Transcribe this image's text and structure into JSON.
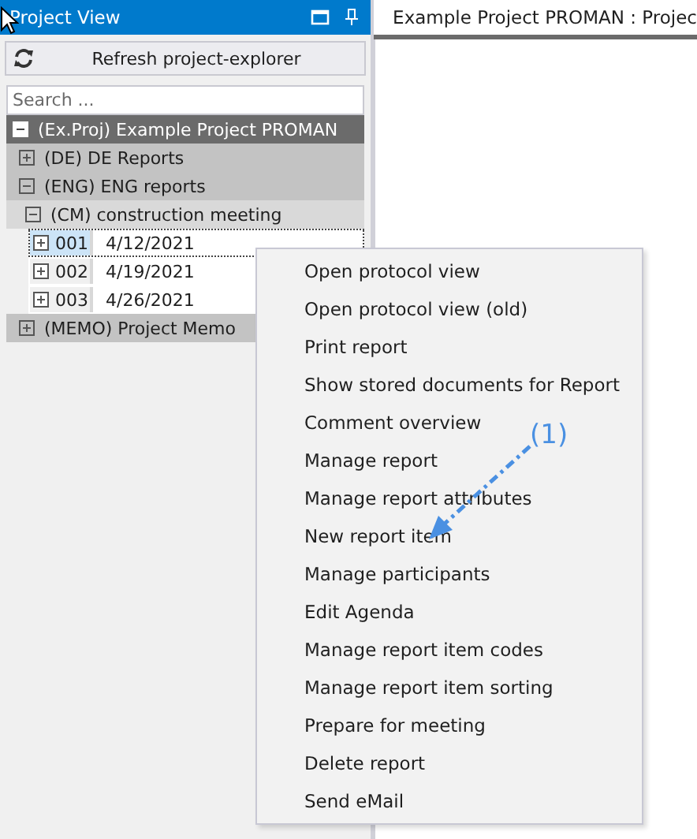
{
  "panel": {
    "title": "Project View",
    "refresh_button": "Refresh project-explorer",
    "search": {
      "placeholder": "Search ..."
    }
  },
  "tree": [
    {
      "label": "(Ex.Proj) Example Project PROMAN",
      "expanded": true,
      "children": [
        {
          "label": "(DE) DE Reports",
          "expanded": false
        },
        {
          "label": "(ENG) ENG reports",
          "expanded": true,
          "children": [
            {
              "label": "(CM) construction meeting",
              "expanded": true,
              "children": [
                {
                  "kind": "report",
                  "number": "001",
                  "date": "4/12/2021",
                  "expanded": false,
                  "selected": true
                },
                {
                  "kind": "report",
                  "number": "002",
                  "date": "4/19/2021",
                  "expanded": false,
                  "selected": false
                },
                {
                  "kind": "report",
                  "number": "003",
                  "date": "4/26/2021",
                  "expanded": false,
                  "selected": false
                }
              ]
            }
          ]
        },
        {
          "label": "(MEMO) Project Memo",
          "expanded": false
        }
      ]
    }
  ],
  "document_tab": {
    "title": "Example Project PROMAN : Projec"
  },
  "context_menu": [
    "Open protocol view",
    "Open protocol view (old)",
    "Print report",
    "Show stored documents for Report",
    "Comment overview",
    "Manage report",
    "Manage report attributes",
    "New report item",
    "Manage participants",
    "Edit Agenda",
    "Manage report item codes",
    "Manage report item sorting",
    "Prepare for meeting",
    "Delete report",
    "Send eMail"
  ],
  "annotation": {
    "label": "(1)"
  }
}
